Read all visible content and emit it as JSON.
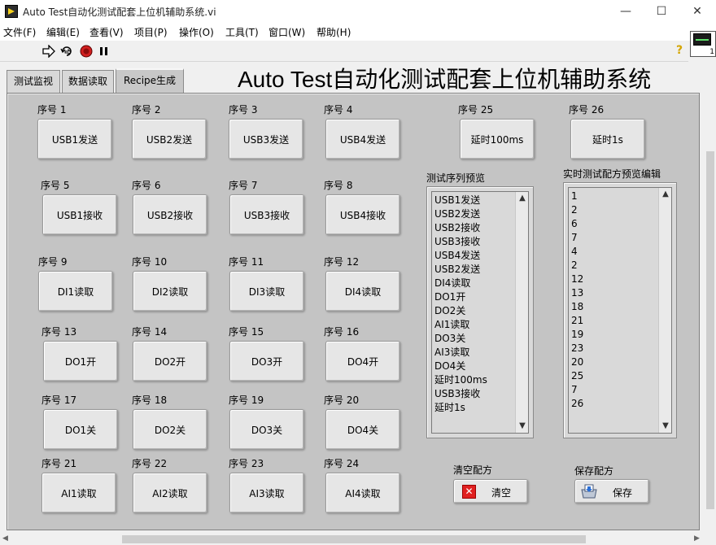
{
  "window": {
    "title": "Auto Test自动化测试配套上位机辅助系统.vi",
    "minimize": "—",
    "maximize": "☐",
    "close": "✕"
  },
  "menu": [
    "文件(F)",
    "编辑(E)",
    "查看(V)",
    "项目(P)",
    "操作(O)",
    "工具(T)",
    "窗口(W)",
    "帮助(H)"
  ],
  "toolbar": {
    "run_icon": "run-arrow-icon",
    "continuous_icon": "run-continuously-icon",
    "abort_icon": "abort-icon",
    "pause_icon": "pause-icon",
    "help": "?",
    "vi_icon_number": "1"
  },
  "tabs": [
    "测试监视",
    "数据读取",
    "Recipe生成"
  ],
  "main_title": "Auto Test自动化测试配套上位机辅助系统",
  "steps": [
    {
      "label": "序号 1",
      "button": "USB1发送"
    },
    {
      "label": "序号 2",
      "button": "USB2发送"
    },
    {
      "label": "序号 3",
      "button": "USB3发送"
    },
    {
      "label": "序号 4",
      "button": "USB4发送"
    },
    {
      "label": "序号 5",
      "button": "USB1接收"
    },
    {
      "label": "序号 6",
      "button": "USB2接收"
    },
    {
      "label": "序号 7",
      "button": "USB3接收"
    },
    {
      "label": "序号 8",
      "button": "USB4接收"
    },
    {
      "label": "序号 9",
      "button": "DI1读取"
    },
    {
      "label": "序号 10",
      "button": "DI2读取"
    },
    {
      "label": "序号 11",
      "button": "DI3读取"
    },
    {
      "label": "序号 12",
      "button": "DI4读取"
    },
    {
      "label": "序号 13",
      "button": "DO1开"
    },
    {
      "label": "序号 14",
      "button": "DO2开"
    },
    {
      "label": "序号 15",
      "button": "DO3开"
    },
    {
      "label": "序号 16",
      "button": "DO4开"
    },
    {
      "label": "序号 17",
      "button": "DO1关"
    },
    {
      "label": "序号 18",
      "button": "DO2关"
    },
    {
      "label": "序号 19",
      "button": "DO3关"
    },
    {
      "label": "序号 20",
      "button": "DO4关"
    },
    {
      "label": "序号 21",
      "button": "AI1读取"
    },
    {
      "label": "序号 22",
      "button": "AI2读取"
    },
    {
      "label": "序号 23",
      "button": "AI3读取"
    },
    {
      "label": "序号 24",
      "button": "AI4读取"
    },
    {
      "label": "序号 25",
      "button": "延时100ms"
    },
    {
      "label": "序号 26",
      "button": "延时1s"
    }
  ],
  "preview": {
    "label": "测试序列预览",
    "items": [
      "USB1发送",
      "USB2发送",
      "USB2接收",
      "USB3接收",
      "USB4发送",
      "USB2发送",
      "DI4读取",
      "DO1开",
      "DO2关",
      "AI1读取",
      "DO3关",
      "AI3读取",
      "DO4关",
      "延时100ms",
      "USB3接收",
      "延时1s"
    ]
  },
  "editor": {
    "label": "实时测试配方预览编辑",
    "items": [
      "1",
      "2",
      "6",
      "7",
      "4",
      "2",
      "12",
      "13",
      "18",
      "21",
      "19",
      "23",
      "20",
      "25",
      "7",
      "26"
    ]
  },
  "clear": {
    "label": "清空配方",
    "button": "清空"
  },
  "save": {
    "label": "保存配方",
    "button": "保存"
  }
}
